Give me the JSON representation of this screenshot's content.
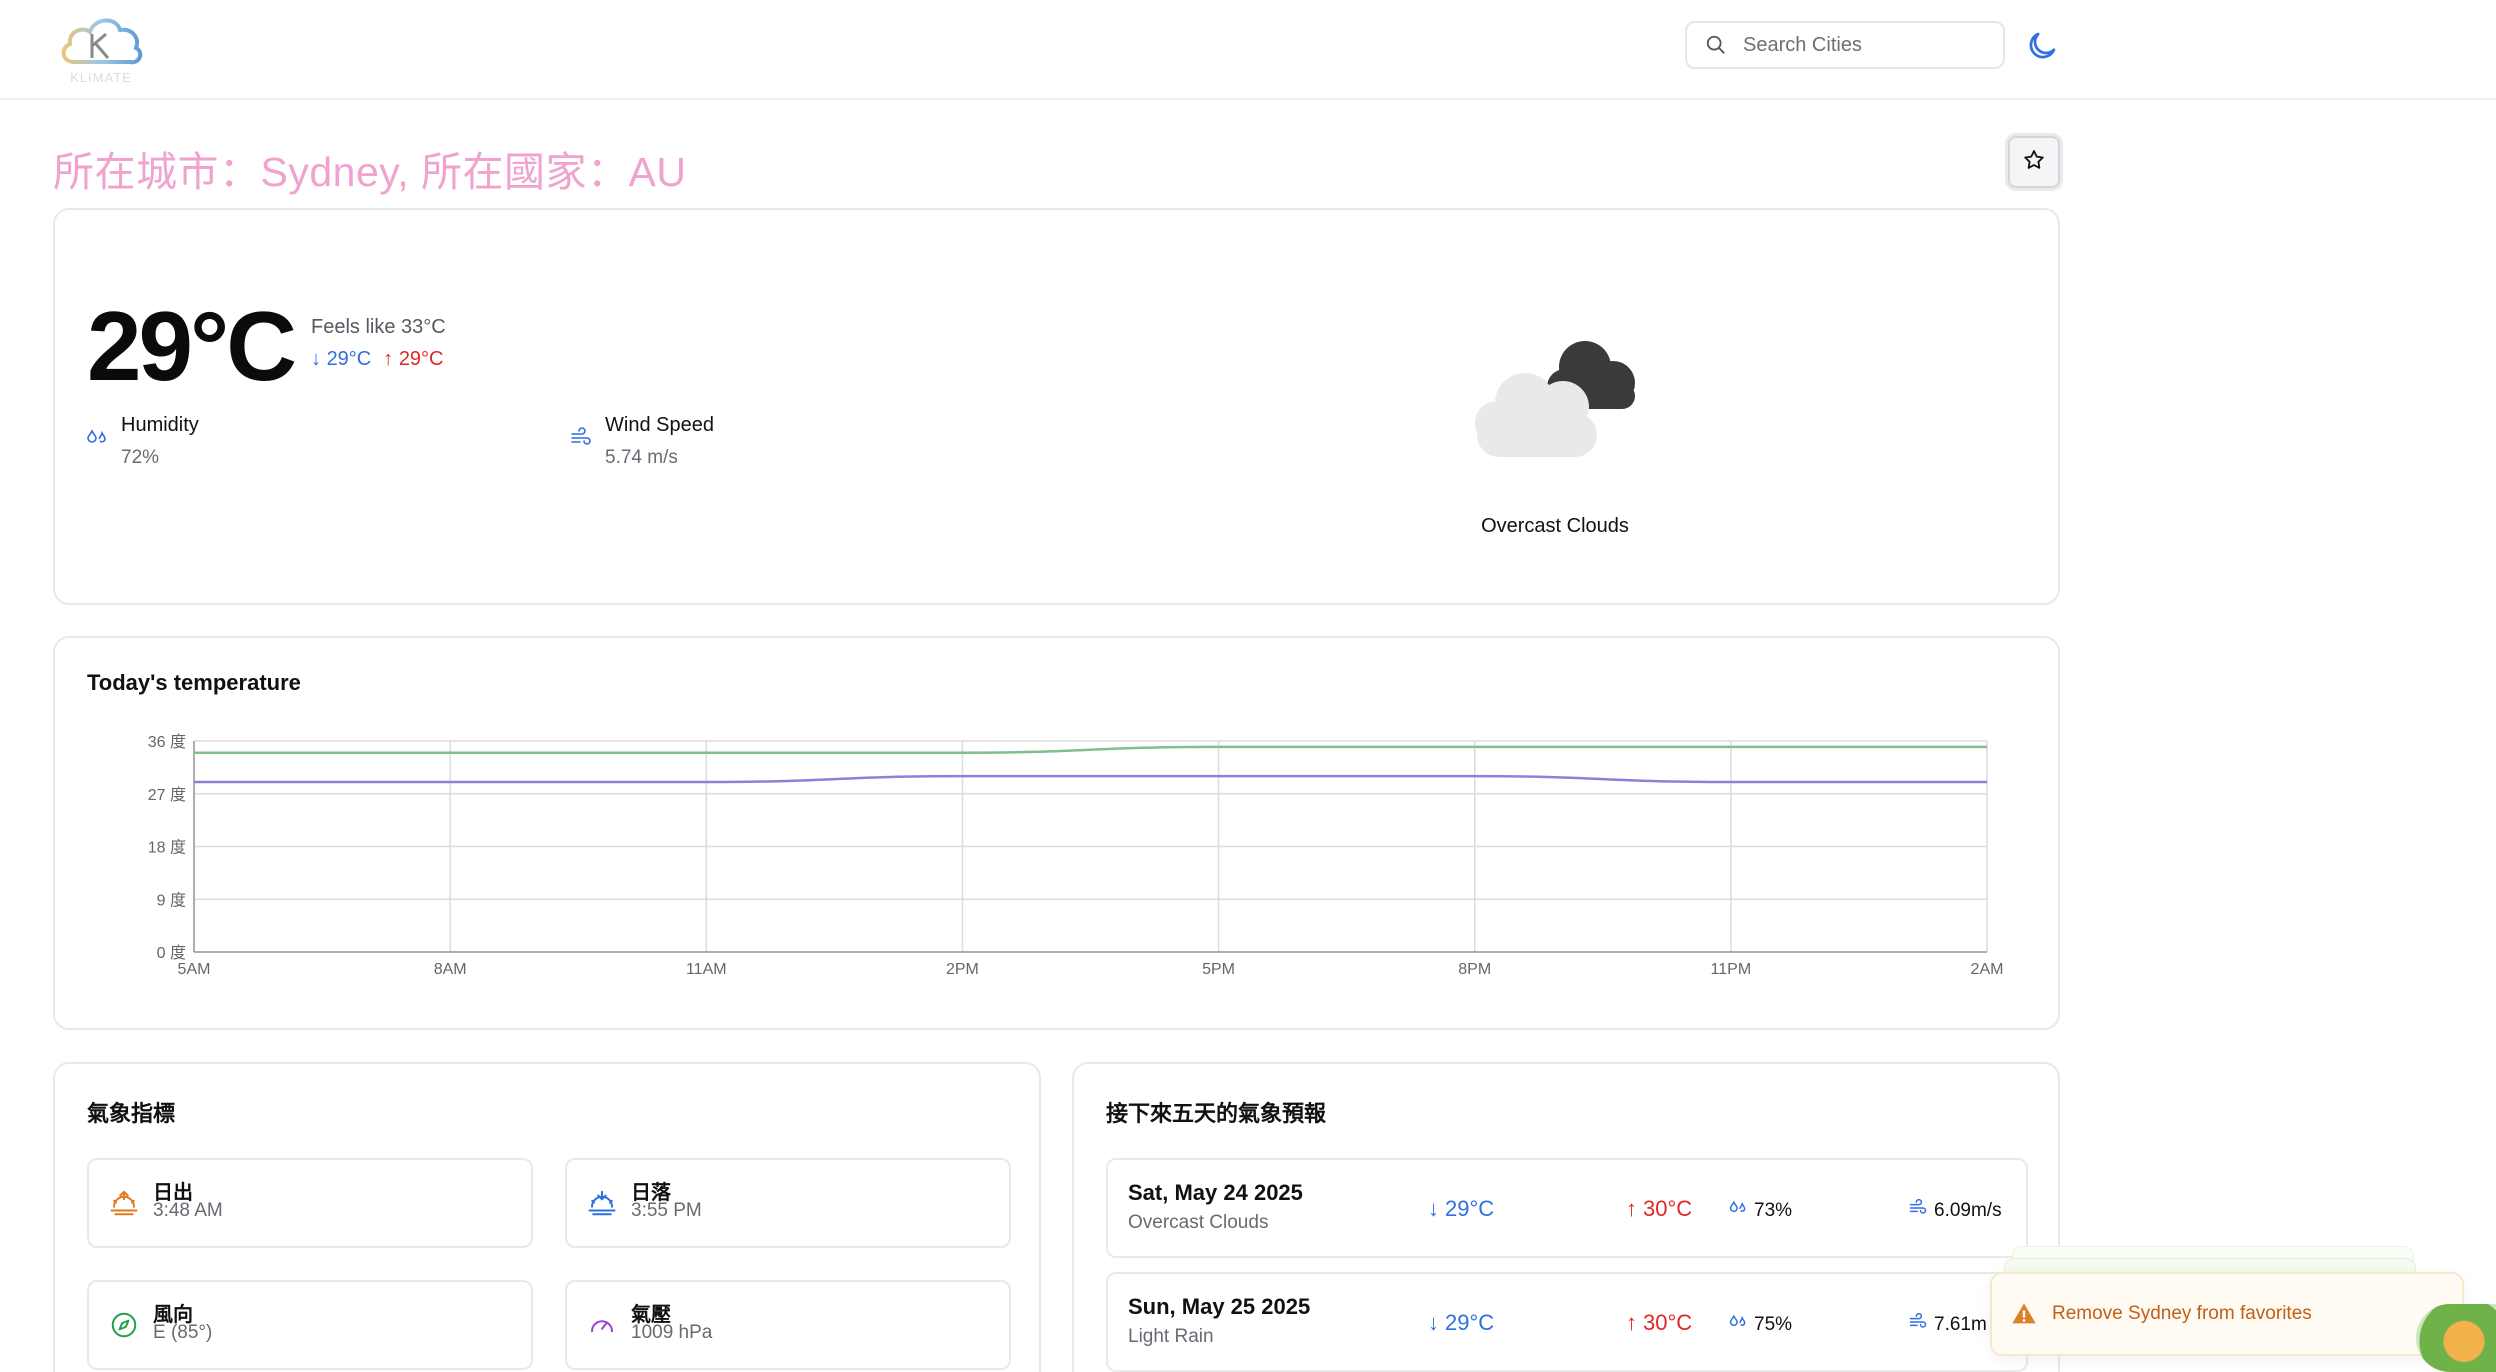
{
  "header": {
    "logo_text": "KLIMATE",
    "search_placeholder": "Search Cities"
  },
  "location": {
    "title": "所在城市：Sydney, 所在國家：AU"
  },
  "current": {
    "temperature": "29°C",
    "feels_like": "Feels like 33°C",
    "temp_min": "29°C",
    "temp_max": "29°C",
    "humidity_label": "Humidity",
    "humidity_value": "72%",
    "wind_label": "Wind Speed",
    "wind_value": "5.74 m/s",
    "description": "Overcast Clouds"
  },
  "chart_title": "Today's temperature",
  "chart_data": {
    "type": "line",
    "categories": [
      "5AM",
      "8AM",
      "11AM",
      "2PM",
      "5PM",
      "8PM",
      "11PM",
      "2AM"
    ],
    "series": [
      {
        "color": "#7fbf8e",
        "values": [
          34,
          34,
          34,
          34,
          35,
          35,
          35,
          35
        ]
      },
      {
        "color": "#8884d8",
        "values": [
          29,
          29,
          29,
          30,
          30,
          30,
          29,
          29
        ]
      }
    ],
    "y_ticks": [
      "0 度",
      "9 度",
      "18 度",
      "27 度",
      "36 度"
    ],
    "ylim": [
      0,
      36
    ],
    "grid": true
  },
  "metrics": {
    "title": "氣象指標",
    "items": [
      {
        "label": "日出",
        "value": "3:48 AM",
        "icon": "sunrise-icon"
      },
      {
        "label": "日落",
        "value": "3:55 PM",
        "icon": "sunset-icon"
      },
      {
        "label": "風向",
        "value": "E (85°)",
        "icon": "compass-icon"
      },
      {
        "label": "氣壓",
        "value": "1009 hPa",
        "icon": "gauge-icon"
      }
    ]
  },
  "forecast": {
    "title": "接下來五天的氣象預報",
    "days": [
      {
        "date": "Sat, May 24 2025",
        "desc": "Overcast Clouds",
        "min": "29°C",
        "max": "30°C",
        "humidity": "73%",
        "wind": "6.09m/s"
      },
      {
        "date": "Sun, May 25 2025",
        "desc": "Light Rain",
        "min": "29°C",
        "max": "30°C",
        "humidity": "75%",
        "wind": "7.61m"
      }
    ]
  },
  "toast": {
    "message": "Remove Sydney from favorites"
  },
  "colors": {
    "title_pink": "#f0a3cf",
    "min_blue": "#2f6fe0",
    "max_red": "#e02727",
    "toast_orange": "#c15f16"
  }
}
